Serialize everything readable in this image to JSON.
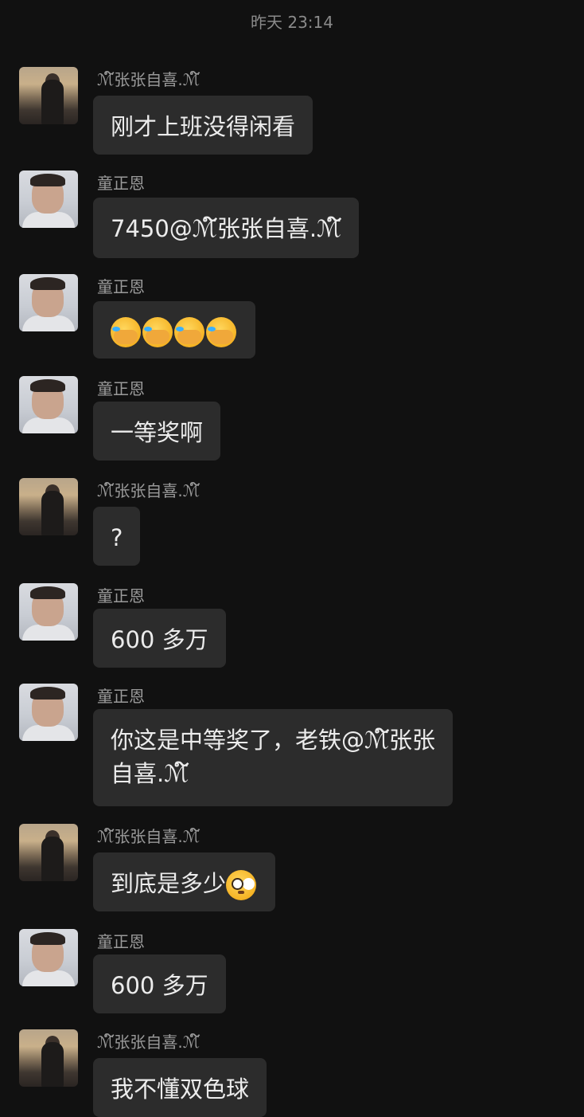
{
  "timestamp": "昨天 23:14",
  "messages": [
    {
      "sender": "ℳ໌张张自喜.ℳ໌",
      "text": "刚才上班没得闲看",
      "avatar": "zhang-avatar"
    },
    {
      "sender": "童正恩",
      "text": "7450@ℳ໌张张自喜.ℳ໌",
      "avatar": "tong-avatar"
    },
    {
      "sender": "童正恩",
      "text": "",
      "emojis": [
        "facepalm-emoji",
        "facepalm-emoji",
        "facepalm-emoji",
        "facepalm-emoji"
      ],
      "avatar": "tong-avatar"
    },
    {
      "sender": "童正恩",
      "text": "一等奖啊",
      "avatar": "tong-avatar"
    },
    {
      "sender": "ℳ໌张张自喜.ℳ໌",
      "text": "?",
      "avatar": "zhang-avatar"
    },
    {
      "sender": "童正恩",
      "text": "600 多万",
      "avatar": "tong-avatar"
    },
    {
      "sender": "童正恩",
      "text": "你这是中等奖了，老铁@ℳ໌张张",
      "text_line2": "自喜.ℳ໌",
      "avatar": "tong-avatar"
    },
    {
      "sender": "ℳ໌张张自喜.ℳ໌",
      "text": "到底是多少",
      "emojis": [
        "flushed-emoji"
      ],
      "avatar": "zhang-avatar"
    },
    {
      "sender": "童正恩",
      "text": "600 多万",
      "avatar": "tong-avatar"
    },
    {
      "sender": "ℳ໌张张自喜.ℳ໌",
      "text": "我不懂双色球",
      "avatar": "zhang-avatar"
    }
  ]
}
